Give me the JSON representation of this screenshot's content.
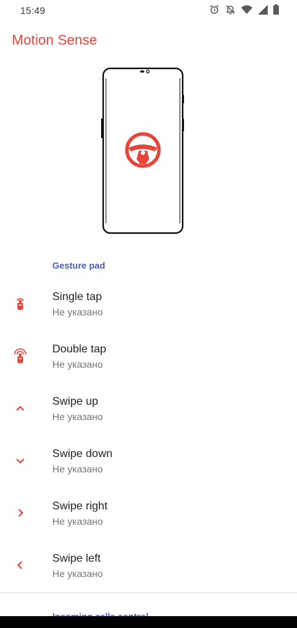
{
  "status_bar": {
    "time": "15:49",
    "icons": [
      "alarm-icon",
      "silent-bell-icon",
      "wifi-icon",
      "signal-icon",
      "battery-icon"
    ]
  },
  "app_bar": {
    "title": "Motion Sense"
  },
  "illustration": {
    "icon": "steering-wheel-icon"
  },
  "sections": {
    "gesture_pad": "Gesture pad",
    "incoming_calls": "Incoming calls control"
  },
  "gestures": [
    {
      "title": "Single tap",
      "summary": "Не указано",
      "icon": "single-tap-icon"
    },
    {
      "title": "Double tap",
      "summary": "Не указано",
      "icon": "double-tap-icon"
    },
    {
      "title": "Swipe up",
      "summary": "Не указано",
      "icon": "chevron-up-icon"
    },
    {
      "title": "Swipe down",
      "summary": "Не указано",
      "icon": "chevron-down-icon"
    },
    {
      "title": "Swipe right",
      "summary": "Не указано",
      "icon": "chevron-right-icon"
    },
    {
      "title": "Swipe left",
      "summary": "Не указано",
      "icon": "chevron-left-icon"
    }
  ],
  "colors": {
    "accent": "#e8453a",
    "section_header": "#4a5fb5"
  }
}
